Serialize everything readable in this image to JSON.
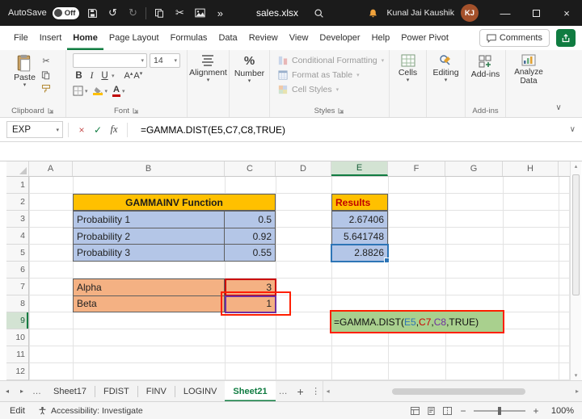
{
  "title_bar": {
    "autosave_label": "AutoSave",
    "autosave_state": "Off",
    "file_name": "sales.xlsx",
    "user_name": "Kunal Jai Kaushik",
    "user_initials": "KJ"
  },
  "menu": {
    "tabs": [
      "File",
      "Insert",
      "Home",
      "Page Layout",
      "Formulas",
      "Data",
      "Review",
      "View",
      "Developer",
      "Help",
      "Power Pivot"
    ],
    "active_tab": "Home",
    "comments_label": "Comments"
  },
  "ribbon": {
    "paste_label": "Paste",
    "group_clipboard": "Clipboard",
    "font_name": "",
    "font_size": "14",
    "group_font": "Font",
    "alignment_label": "Alignment",
    "number_label": "Number",
    "styles_items": [
      "Conditional Formatting",
      "Format as Table",
      "Cell Styles"
    ],
    "group_styles": "Styles",
    "cells_label": "Cells",
    "editing_label": "Editing",
    "addins_label": "Add-ins",
    "group_addins": "Add-ins",
    "analyze_label": "Analyze Data",
    "format": {
      "bold": "B",
      "italic": "I",
      "underline": "U",
      "letter": "A"
    }
  },
  "formula_bar": {
    "name_box": "EXP",
    "fx_label": "fx",
    "formula": "=GAMMA.DIST(E5,C7,C8,TRUE)"
  },
  "grid": {
    "columns": [
      "A",
      "B",
      "C",
      "D",
      "E",
      "F",
      "G",
      "H"
    ],
    "rows": [
      "1",
      "2",
      "3",
      "4",
      "5",
      "6",
      "7",
      "8",
      "9",
      "10",
      "11",
      "12"
    ],
    "active_column": "E",
    "active_row": "9",
    "cells": {
      "gamma_header": "GAMMAINV Function",
      "prob_rows": [
        {
          "label": "Probability 1",
          "value": "0.5"
        },
        {
          "label": "Probability 2",
          "value": "0.92"
        },
        {
          "label": "Probability 3",
          "value": "0.55"
        }
      ],
      "param_rows": [
        {
          "label": "Alpha",
          "value": "3"
        },
        {
          "label": "Beta",
          "value": "1"
        }
      ],
      "results_header": "Results",
      "results": [
        "2.67406",
        "5.641748",
        "2.8826"
      ]
    },
    "formula_cell": {
      "pre": "=GAMMA.DIST(",
      "ref1": "E5",
      "c1": ",",
      "ref2": "C7",
      "c2": ",",
      "ref3": "C8",
      "c3": ",",
      "arg": "TRUE",
      "post": ")"
    }
  },
  "sheet_tabs": {
    "tabs": [
      "Sheet17",
      "FDIST",
      "FINV",
      "LOGINV",
      "Sheet21"
    ],
    "active": "Sheet21"
  },
  "status_bar": {
    "mode": "Edit",
    "accessibility": "Accessibility: Investigate",
    "zoom": "100%"
  },
  "icons": {
    "dropdown": "▾",
    "undo": "↺",
    "redo": "↻",
    "scissors": "✂",
    "overflow": "»",
    "close": "×",
    "minimize": "—",
    "check": "✓",
    "cancel": "×",
    "expand": "∨",
    "ellipsis": "…",
    "plus": "+",
    "minus": "−",
    "tri_left": "◂",
    "tri_right": "▸",
    "tri_up": "▴",
    "tri_down": "▾",
    "dots": "⋮",
    "percent": "%"
  },
  "colors": {
    "titlebar": "#1b1b1b",
    "green": "#107C41",
    "gold": "#FFC000",
    "blue_fill": "#B4C6E7",
    "orange_fill": "#F4B183",
    "green_fill": "#A9D08E",
    "ref_blue": "#2E75B6",
    "ref_red": "#CC0000",
    "ref_purple": "#7030A0",
    "anno_red": "#FF1F00",
    "results_red": "#C00000",
    "hdr_sel": "#D3E3D3",
    "avatar_bg": "#A4512B",
    "bell": "#F2A33C"
  }
}
